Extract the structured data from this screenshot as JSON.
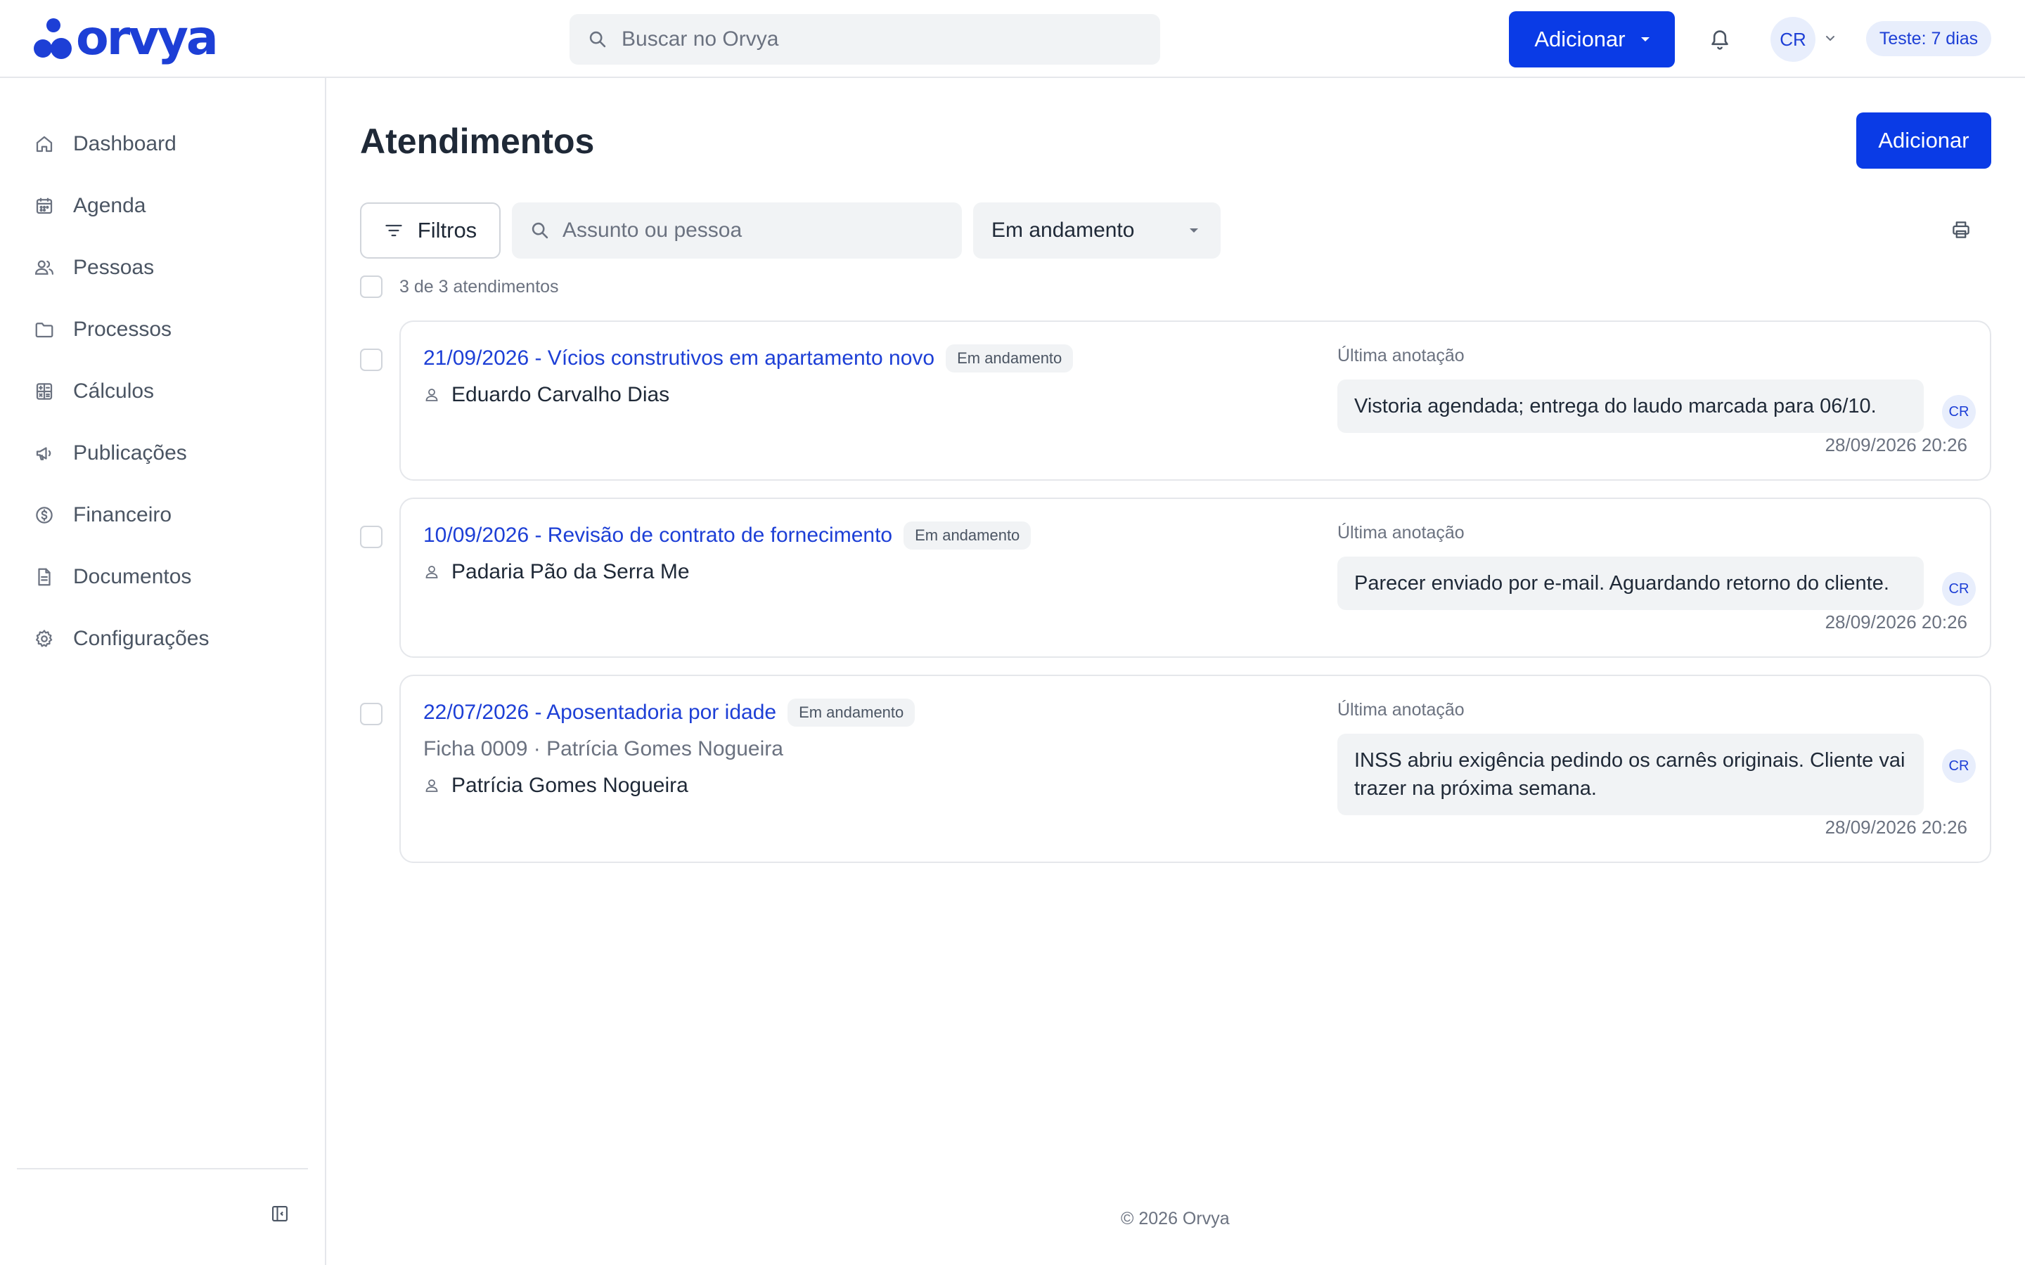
{
  "header": {
    "logo_text": "orvya",
    "search_placeholder": "Buscar no Orvya",
    "add_label": "Adicionar",
    "user_initials": "CR",
    "trial_badge": "Teste: 7 dias"
  },
  "sidebar": {
    "items": [
      {
        "label": "Dashboard",
        "icon": "home-icon"
      },
      {
        "label": "Agenda",
        "icon": "calendar-icon"
      },
      {
        "label": "Pessoas",
        "icon": "users-icon"
      },
      {
        "label": "Processos",
        "icon": "folder-icon"
      },
      {
        "label": "Cálculos",
        "icon": "calculator-icon"
      },
      {
        "label": "Publicações",
        "icon": "megaphone-icon"
      },
      {
        "label": "Financeiro",
        "icon": "dollar-icon"
      },
      {
        "label": "Documentos",
        "icon": "document-icon"
      },
      {
        "label": "Configurações",
        "icon": "gear-icon"
      }
    ]
  },
  "main": {
    "title": "Atendimentos",
    "add_label": "Adicionar",
    "filters_label": "Filtros",
    "search_placeholder": "Assunto ou pessoa",
    "status_filter": "Em andamento",
    "count_text": "3 de 3 atendimentos",
    "note_label": "Última anotação",
    "cards": [
      {
        "title": "21/09/2026 - Vícios construtivos em apartamento novo",
        "status": "Em andamento",
        "ficha": "",
        "person": "Eduardo Carvalho Dias",
        "note": "Vistoria agendada; entrega do laudo marcada para 06/10.",
        "note_author": "CR",
        "note_date": "28/09/2026 20:26"
      },
      {
        "title": "10/09/2026 - Revisão de contrato de fornecimento",
        "status": "Em andamento",
        "ficha": "",
        "person": "Padaria Pão da Serra Me",
        "note": "Parecer enviado por e-mail. Aguardando retorno do cliente.",
        "note_author": "CR",
        "note_date": "28/09/2026 20:26"
      },
      {
        "title": "22/07/2026 - Aposentadoria por idade",
        "status": "Em andamento",
        "ficha": "Ficha 0009 · Patrícia Gomes Nogueira",
        "person": "Patrícia Gomes Nogueira",
        "note": "INSS abriu exigência pedindo os carnês originais. Cliente vai trazer na próxima semana.",
        "note_author": "CR",
        "note_date": "28/09/2026 20:26"
      }
    ]
  },
  "footer": {
    "text": "© 2026 Orvya"
  },
  "colors": {
    "accent": "#0a3be6",
    "brand": "#1d3fd6",
    "muted": "#6b7280",
    "surface": "#f1f3f5"
  }
}
